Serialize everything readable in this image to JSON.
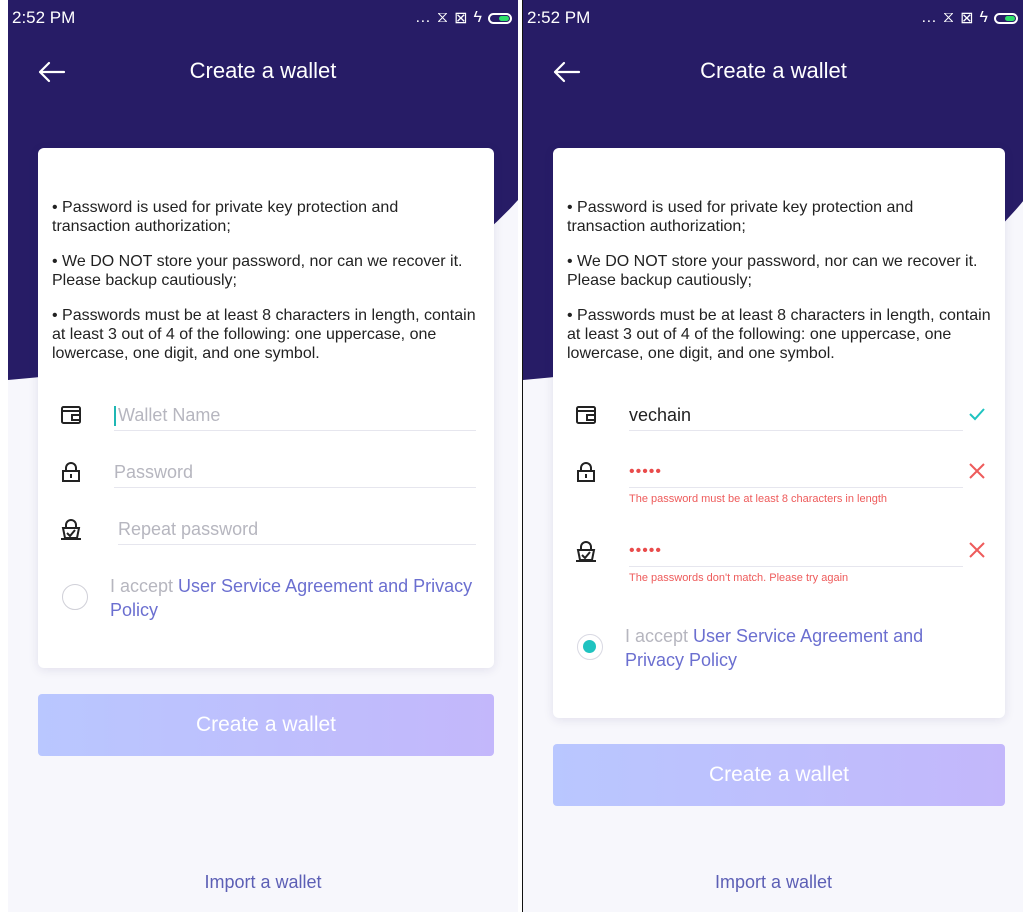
{
  "status": {
    "time": "2:52 PM",
    "icons": [
      "more-icon",
      "wifi-icon",
      "sim-icon",
      "charging-icon",
      "battery-icon"
    ]
  },
  "nav": {
    "title": "Create a wallet"
  },
  "tips": [
    "• Password is used for private key protection and transaction authorization;",
    "• We DO NOT store your password, nor can we recover it. Please backup cautiously;",
    "• Passwords must be at least 8 characters in length, contain at least 3 out of 4 of the following: one uppercase, one lowercase, one digit, and one symbol."
  ],
  "form": {
    "wallet_name_placeholder": "Wallet Name",
    "password_placeholder": "Password",
    "repeat_placeholder": "Repeat password",
    "accept_prefix": "I accept ",
    "accept_link": "User Service Agreement and Privacy Policy"
  },
  "filled": {
    "wallet_name": "vechain",
    "password": "•••••",
    "repeat": "•••••",
    "password_error": "The password must be at least 8 characters in length",
    "repeat_error": "The passwords don't match. Please try again"
  },
  "buttons": {
    "create": "Create a wallet",
    "import": "Import a wallet"
  },
  "colors": {
    "header": "#271c66",
    "accent_teal": "#1fc3c0",
    "error": "#ee5b5b",
    "link": "#6b6fd0",
    "button": "#bcc0fd"
  }
}
